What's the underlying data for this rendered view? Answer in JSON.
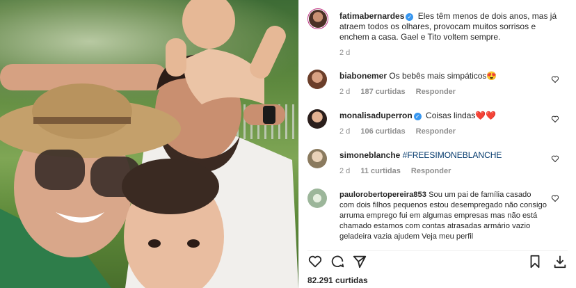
{
  "post": {
    "author": "fatimabernardes",
    "caption": "Eles têm menos de dois anos, mas já atraem todos os olhares, provocam muitos sorrisos e enchem a casa. Gael e Tito voltem sempre.",
    "time": "2 d"
  },
  "comments": [
    {
      "user": "biabonemer",
      "verified": false,
      "text": "Os bebês mais simpáticos😍",
      "time": "2 d",
      "likes": "187 curtidas",
      "reply": "Responder"
    },
    {
      "user": "monalisaduperron",
      "verified": true,
      "text": "Coisas lindas❤️❤️",
      "time": "2 d",
      "likes": "106 curtidas",
      "reply": "Responder"
    },
    {
      "user": "simoneblanche",
      "verified": false,
      "text": "#FREESIMONEBLANCHE",
      "time": "2 d",
      "likes": "11 curtidas",
      "reply": "Responder"
    },
    {
      "user": "paulorobertopereira853",
      "verified": false,
      "text": "Sou um pai de família casado com dois filhos pequenos estou desempregado não consigo arruma emprego fui em algumas empresas mas não está chamado estamos com contas atrasadas armário vazio geladeira vazia ajudem Veja meu perfil"
    }
  ],
  "likes_total": "82.291 curtidas",
  "colors": {
    "link": "#00376b",
    "verified": "#3897f0",
    "muted": "#8e8e8e",
    "text": "#262626"
  }
}
